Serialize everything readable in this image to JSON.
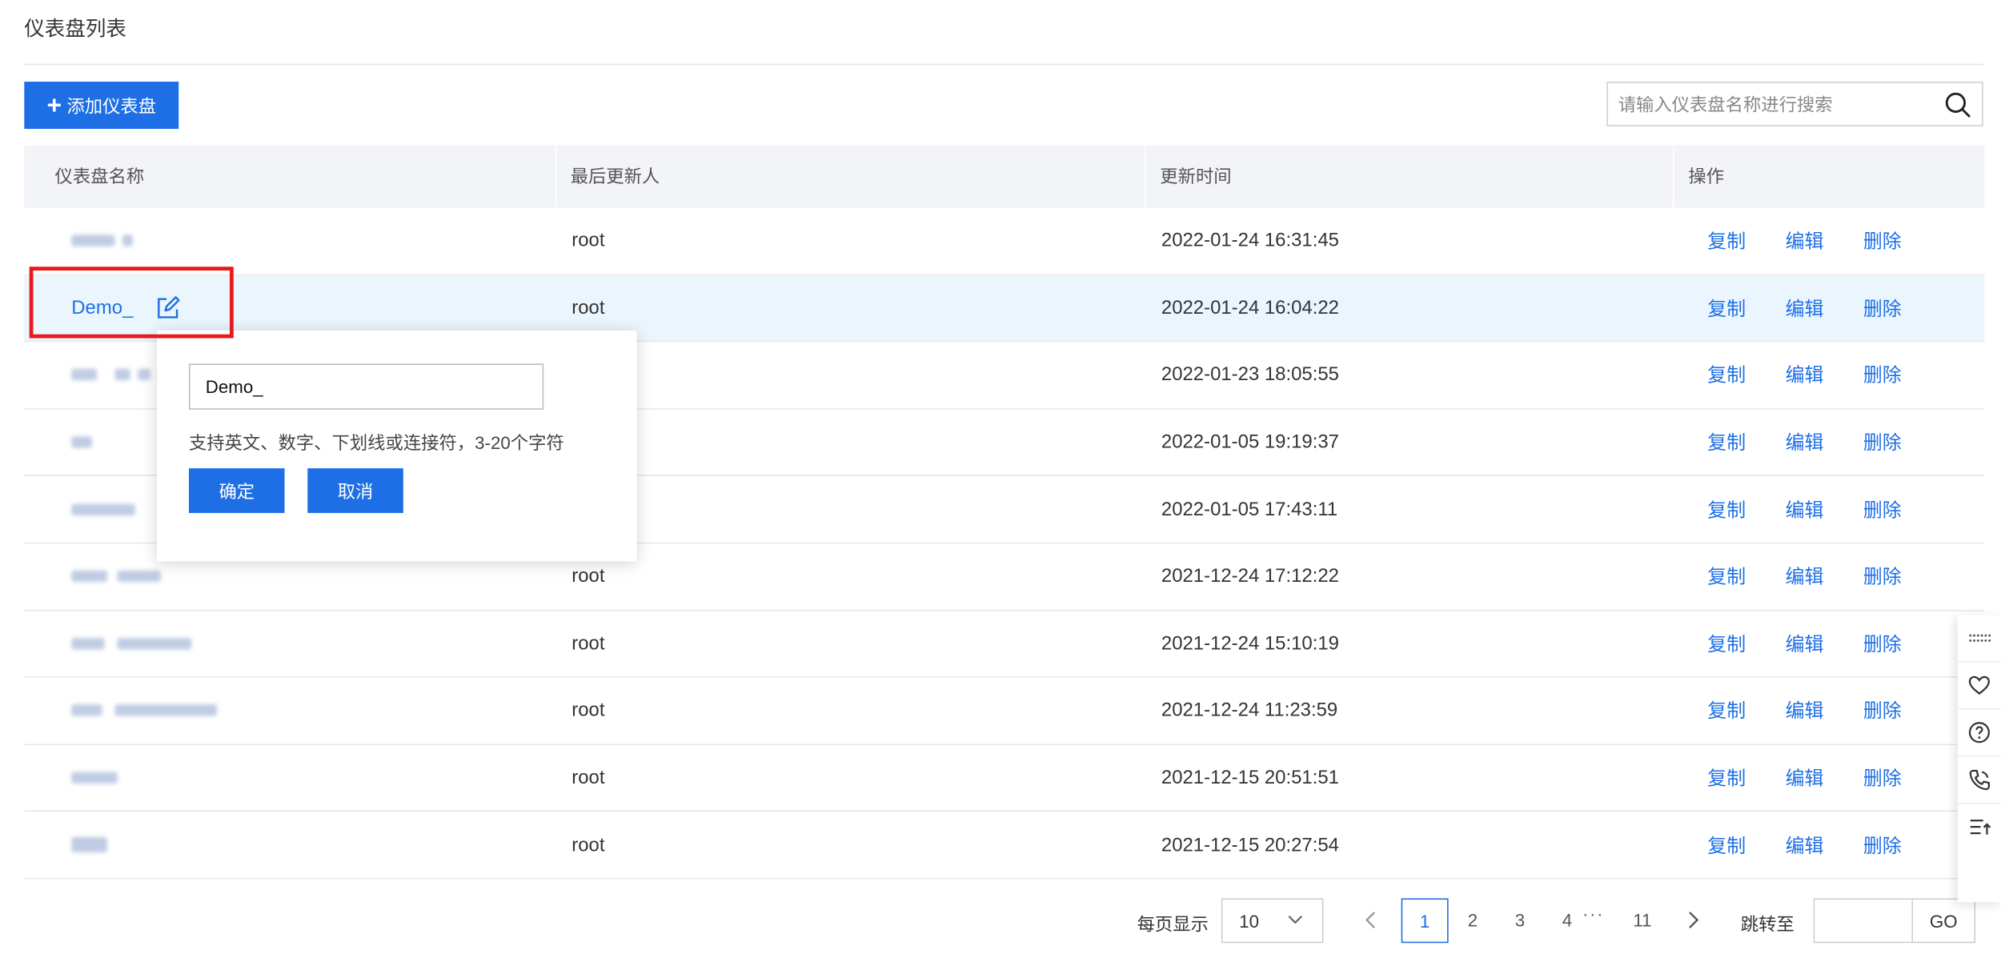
{
  "page": {
    "title": "仪表盘列表"
  },
  "toolbar": {
    "add_label": "添加仪表盘",
    "search_placeholder": "请输入仪表盘名称进行搜索"
  },
  "table": {
    "columns": [
      "仪表盘名称",
      "最后更新人",
      "更新时间",
      "操作"
    ],
    "actions": [
      "复制",
      "编辑",
      "删除"
    ],
    "rows": [
      {
        "name": "",
        "user": "root",
        "time": "2022-01-24 16:31:45"
      },
      {
        "name": "Demo_",
        "user": "root",
        "time": "2022-01-24 16:04:22"
      },
      {
        "name": "",
        "user": "",
        "time": "2022-01-23 18:05:55"
      },
      {
        "name": "",
        "user": "",
        "time": "2022-01-05 19:19:37"
      },
      {
        "name": "",
        "user": "",
        "time": "2022-01-05 17:43:11"
      },
      {
        "name": "",
        "user": "root",
        "time": "2021-12-24 17:12:22"
      },
      {
        "name": "",
        "user": "root",
        "time": "2021-12-24 15:10:19"
      },
      {
        "name": "",
        "user": "root",
        "time": "2021-12-24 11:23:59"
      },
      {
        "name": "",
        "user": "root",
        "time": "2021-12-15 20:51:51"
      },
      {
        "name": "",
        "user": "root",
        "time": "2021-12-15 20:27:54"
      }
    ]
  },
  "rename_popover": {
    "value": "Demo_",
    "hint": "支持英文、数字、下划线或连接符，3-20个字符",
    "confirm_label": "确定",
    "cancel_label": "取消"
  },
  "pagination": {
    "per_page_label": "每页显示",
    "per_page_value": "10",
    "pages": [
      "1",
      "2",
      "3",
      "4"
    ],
    "ellipsis": "···",
    "last_page": "11",
    "current_page": "1",
    "jump_label": "跳转至",
    "go_label": "GO"
  },
  "colors": {
    "accent": "#1e6fe6",
    "highlight_row": "#eaf5fd",
    "annotation_red": "#e8191a",
    "header_bg": "#f3f4f7"
  },
  "icons": {
    "add": "plus-icon",
    "search": "search-icon",
    "rename": "edit-icon",
    "side_tools": [
      "drag-handle-icon",
      "heart-icon",
      "help-icon",
      "phone-icon",
      "list-top-icon"
    ]
  }
}
